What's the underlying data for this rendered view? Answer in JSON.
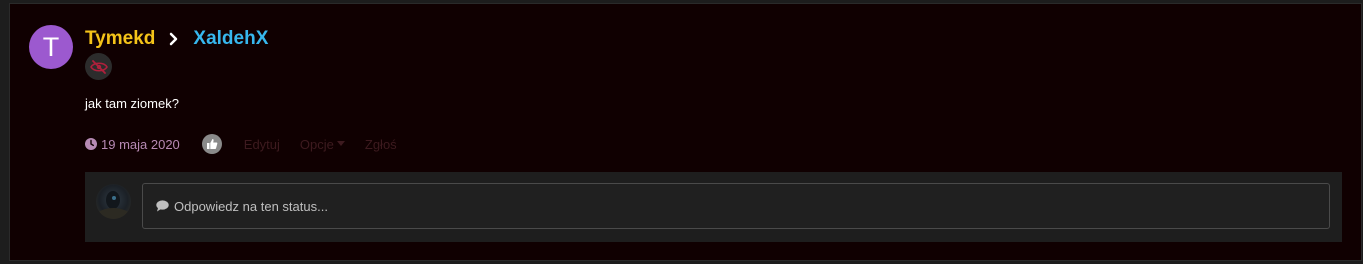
{
  "status": {
    "author": {
      "initial": "T",
      "name": "Tymekd",
      "avatar_color": "#9c59cf",
      "name_color": "#f5c419"
    },
    "target": {
      "name": "XaldehX",
      "name_color": "#37b7ee"
    },
    "hidden_icon": "eye-slash-icon",
    "message": "jak tam ziomek?",
    "date": "19 maja 2020",
    "actions": {
      "edit": "Edytuj",
      "options": "Opcje",
      "report": "Zgłoś"
    }
  },
  "reply": {
    "placeholder": "Odpowiedz na ten status..."
  }
}
